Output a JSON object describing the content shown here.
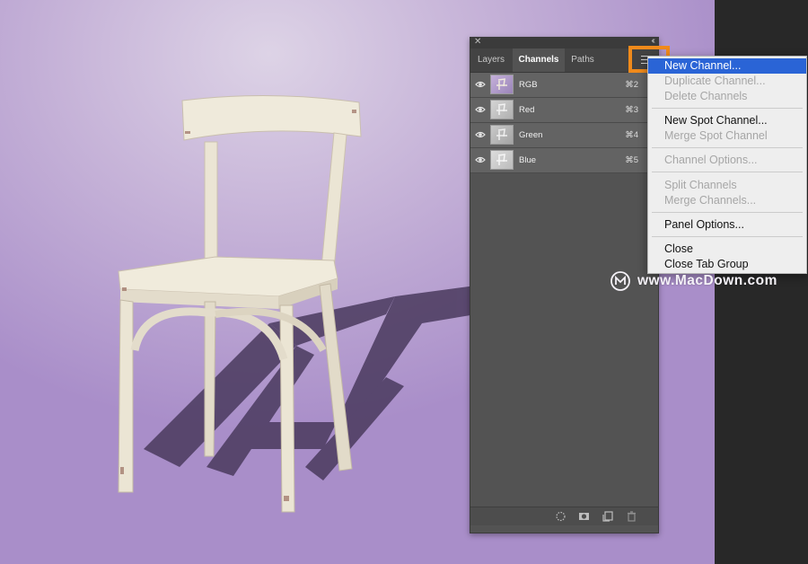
{
  "panel": {
    "tabs": [
      {
        "label": "Layers"
      },
      {
        "label": "Channels"
      },
      {
        "label": "Paths"
      }
    ],
    "active_tab": "Channels",
    "channels": [
      {
        "name": "RGB",
        "shortcut": "⌘2"
      },
      {
        "name": "Red",
        "shortcut": "⌘3"
      },
      {
        "name": "Green",
        "shortcut": "⌘4"
      },
      {
        "name": "Blue",
        "shortcut": "⌘5"
      }
    ],
    "footer_icons": [
      "load-selection-icon",
      "save-selection-icon",
      "new-channel-icon",
      "trash-icon"
    ]
  },
  "flyout_menu": {
    "items": [
      {
        "label": "New Channel...",
        "state": "selected"
      },
      {
        "label": "Duplicate Channel...",
        "state": "disabled"
      },
      {
        "label": "Delete Channels",
        "state": "disabled"
      },
      {
        "label": "New Spot Channel...",
        "state": "enabled"
      },
      {
        "label": "Merge Spot Channel",
        "state": "disabled"
      },
      {
        "label": "Channel Options...",
        "state": "disabled"
      },
      {
        "label": "Split Channels",
        "state": "disabled"
      },
      {
        "label": "Merge Channels...",
        "state": "disabled"
      },
      {
        "label": "Panel Options...",
        "state": "enabled"
      },
      {
        "label": "Close",
        "state": "enabled"
      },
      {
        "label": "Close Tab Group",
        "state": "enabled"
      }
    ]
  },
  "watermark": {
    "text": "www.MacDown.com"
  },
  "colors": {
    "highlight": "#f08a1b",
    "menu_selection": "#2a64d6",
    "panel_bg": "#535353",
    "canvas_bg": "#b79fd0"
  }
}
